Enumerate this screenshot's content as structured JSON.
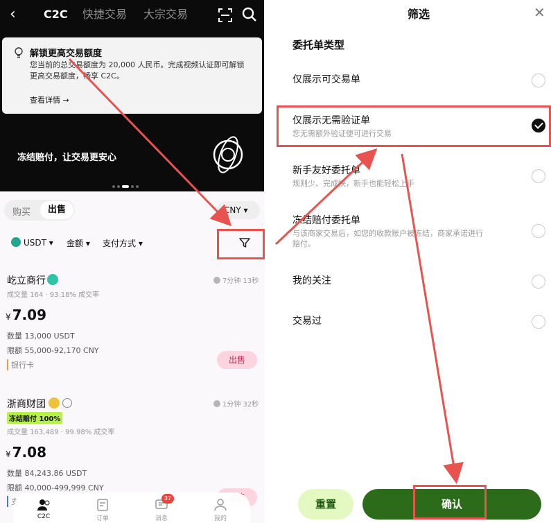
{
  "left": {
    "nav": {
      "back_icon": "back-arrow-icon",
      "tabs": [
        "C2C",
        "快捷交易",
        "大宗交易"
      ],
      "active_tab": "C2C"
    },
    "promo": {
      "title": "解锁更高交易额度",
      "desc": "您当前的总交易额度为 20,000 人民币。完成视频认证即可解锁更高交易额度，畅享 C2C。",
      "more": "查看详情 →"
    },
    "slogan": "冻结赔付，让交易更安心",
    "segment": {
      "buy": "购买",
      "sell": "出售"
    },
    "currency": "CNY ▾",
    "filters": {
      "coin": "USDT ▾",
      "amount": "金额 ▾",
      "payment": "支付方式 ▾"
    },
    "merchants": [
      {
        "name": "屹立商行",
        "time": "7分钟 13秒",
        "stats": "成交量 164 · 93.18% 成交率",
        "currency_symbol": "¥",
        "price": "7.09",
        "qty": "数量 13,000 USDT",
        "limit": "限额 55,000-92,170 CNY",
        "pay": "银行卡",
        "action": "出售"
      },
      {
        "name": "浙商财团",
        "tag": "冻结赔付 100%",
        "time": "1分钟 32秒",
        "stats": "成交量 163,489 · 99.98% 成交率",
        "currency_symbol": "¥",
        "price": "7.08",
        "qty": "数量 84,243.86 USDT",
        "limit": "限额 40,000-499,999 CNY",
        "pay": "支",
        "action": "出售"
      }
    ],
    "bottom_nav": [
      {
        "label": "C2C",
        "icon": "c2c-users-icon"
      },
      {
        "label": "订单",
        "icon": "orders-icon"
      },
      {
        "label": "消息",
        "icon": "messages-icon",
        "badge": "37"
      },
      {
        "label": "我的",
        "icon": "profile-icon"
      }
    ]
  },
  "right": {
    "title": "筛选",
    "section": "委托单类型",
    "options": [
      {
        "label": "仅展示可交易单",
        "sub": "",
        "checked": false
      },
      {
        "label": "仅展示无需验证单",
        "sub": "您无需额外验证便可进行交易",
        "checked": true
      },
      {
        "label": "新手友好委托单",
        "sub": "规则少、完成快，新手也能轻松上手",
        "checked": false
      },
      {
        "label": "冻结赔付委托单",
        "sub": "与该商家交易后，如您的收款账户被冻结，商家承诺进行赔付。",
        "checked": false
      },
      {
        "label": "我的关注",
        "sub": "",
        "checked": false
      },
      {
        "label": "交易过",
        "sub": "",
        "checked": false
      }
    ],
    "reset": "重置",
    "confirm": "确认"
  },
  "colors": {
    "annotation": "#e8534f",
    "confirm": "#2b6b1a",
    "reset_bg": "#e4f8c2",
    "sell_bg": "#fbd4df"
  }
}
